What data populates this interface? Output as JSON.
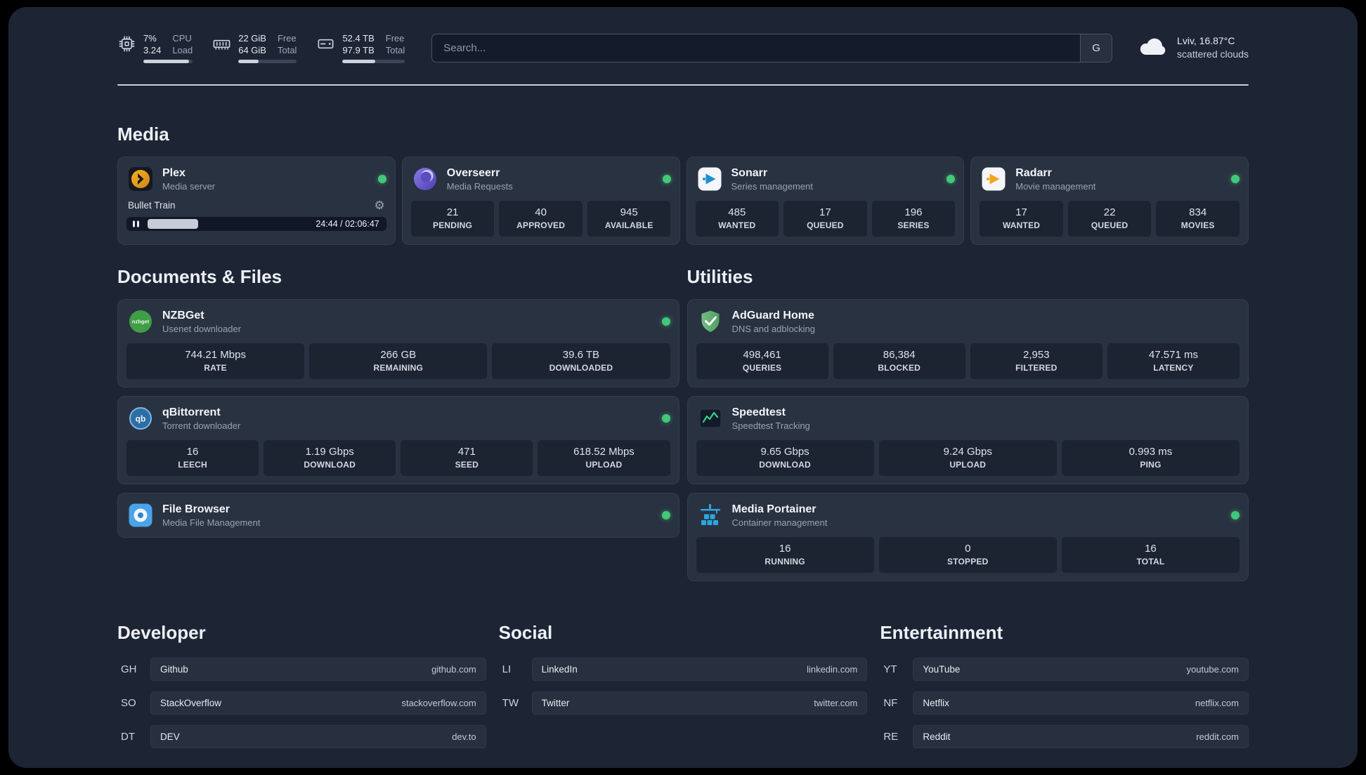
{
  "topbar": {
    "cpu": {
      "line1": "7%",
      "line2": "3.24",
      "label1": "CPU",
      "label2": "Load",
      "free_percent": 93
    },
    "memory": {
      "line1": "22 GiB",
      "line2": "64 GiB",
      "label1": "Free",
      "label2": "Total",
      "free_percent": 34
    },
    "disk": {
      "line1": "52.4 TB",
      "line2": "97.9 TB",
      "label1": "Free",
      "label2": "Total",
      "free_percent": 53
    },
    "search": {
      "placeholder": "Search...",
      "button_label": "G"
    },
    "weather": {
      "location": "Lviv, 16.87°C",
      "condition": "scattered clouds"
    }
  },
  "icons": {
    "gear": "⚙"
  },
  "sections": {
    "media": "Media",
    "documents": "Documents & Files",
    "utilities": "Utilities"
  },
  "services": {
    "plex": {
      "name": "Plex",
      "desc": "Media server",
      "now_playing": "Bullet Train",
      "time": "24:44 / 02:06:47",
      "progress_percent": 19.5
    },
    "overseerr": {
      "name": "Overseerr",
      "desc": "Media Requests",
      "stats": [
        {
          "value": "21",
          "label": "PENDING"
        },
        {
          "value": "40",
          "label": "APPROVED"
        },
        {
          "value": "945",
          "label": "AVAILABLE"
        }
      ]
    },
    "sonarr": {
      "name": "Sonarr",
      "desc": "Series management",
      "stats": [
        {
          "value": "485",
          "label": "WANTED"
        },
        {
          "value": "17",
          "label": "QUEUED"
        },
        {
          "value": "196",
          "label": "SERIES"
        }
      ]
    },
    "radarr": {
      "name": "Radarr",
      "desc": "Movie management",
      "stats": [
        {
          "value": "17",
          "label": "WANTED"
        },
        {
          "value": "22",
          "label": "QUEUED"
        },
        {
          "value": "834",
          "label": "MOVIES"
        }
      ]
    },
    "nzbget": {
      "name": "NZBGet",
      "desc": "Usenet downloader",
      "icon_text": "nzbget",
      "stats": [
        {
          "value": "744.21 Mbps",
          "label": "RATE"
        },
        {
          "value": "266 GB",
          "label": "REMAINING"
        },
        {
          "value": "39.6 TB",
          "label": "DOWNLOADED"
        }
      ]
    },
    "qbittorrent": {
      "name": "qBittorrent",
      "desc": "Torrent downloader",
      "icon_text": "qb",
      "stats": [
        {
          "value": "16",
          "label": "LEECH"
        },
        {
          "value": "1.19 Gbps",
          "label": "DOWNLOAD"
        },
        {
          "value": "471",
          "label": "SEED"
        },
        {
          "value": "618.52 Mbps",
          "label": "UPLOAD"
        }
      ]
    },
    "filebrowser": {
      "name": "File Browser",
      "desc": "Media File Management"
    },
    "adguard": {
      "name": "AdGuard Home",
      "desc": "DNS and adblocking",
      "stats": [
        {
          "value": "498,461",
          "label": "QUERIES"
        },
        {
          "value": "86,384",
          "label": "BLOCKED"
        },
        {
          "value": "2,953",
          "label": "FILTERED"
        },
        {
          "value": "47.571 ms",
          "label": "LATENCY"
        }
      ]
    },
    "speedtest": {
      "name": "Speedtest",
      "desc": "Speedtest Tracking",
      "stats": [
        {
          "value": "9.65 Gbps",
          "label": "DOWNLOAD"
        },
        {
          "value": "9.24 Gbps",
          "label": "UPLOAD"
        },
        {
          "value": "0.993 ms",
          "label": "PING"
        }
      ]
    },
    "portainer": {
      "name": "Media Portainer",
      "desc": "Container management",
      "stats": [
        {
          "value": "16",
          "label": "RUNNING"
        },
        {
          "value": "0",
          "label": "STOPPED"
        },
        {
          "value": "16",
          "label": "TOTAL"
        }
      ]
    }
  },
  "bookmarks": {
    "developer": {
      "title": "Developer",
      "items": [
        {
          "abbr": "GH",
          "name": "Github",
          "url": "github.com"
        },
        {
          "abbr": "SO",
          "name": "StackOverflow",
          "url": "stackoverflow.com"
        },
        {
          "abbr": "DT",
          "name": "DEV",
          "url": "dev.to"
        }
      ]
    },
    "social": {
      "title": "Social",
      "items": [
        {
          "abbr": "LI",
          "name": "LinkedIn",
          "url": "linkedin.com"
        },
        {
          "abbr": "TW",
          "name": "Twitter",
          "url": "twitter.com"
        }
      ]
    },
    "entertainment": {
      "title": "Entertainment",
      "items": [
        {
          "abbr": "YT",
          "name": "YouTube",
          "url": "youtube.com"
        },
        {
          "abbr": "NF",
          "name": "Netflix",
          "url": "netflix.com"
        },
        {
          "abbr": "RE",
          "name": "Reddit",
          "url": "reddit.com"
        }
      ]
    }
  }
}
